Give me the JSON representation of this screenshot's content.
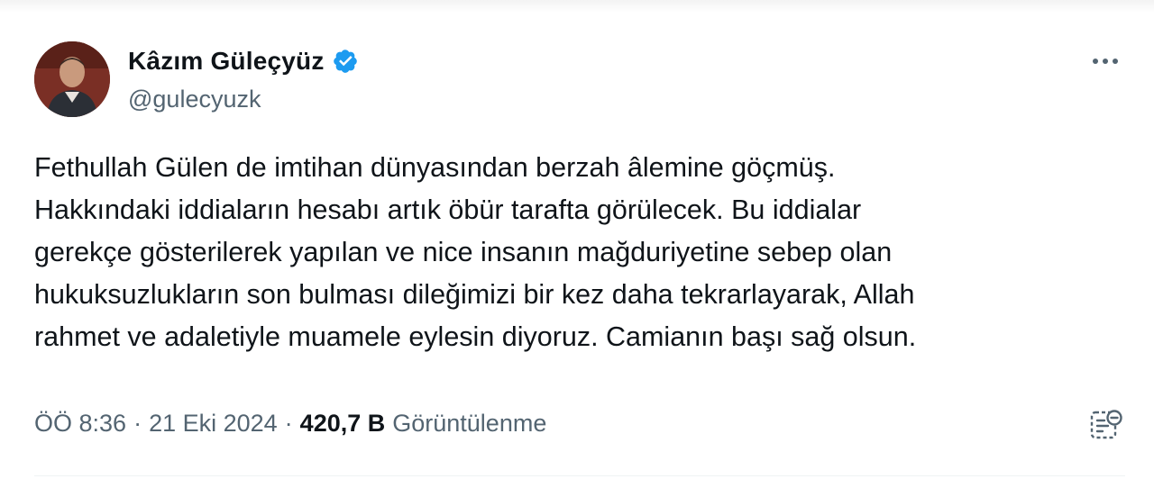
{
  "author": {
    "display_name": "Kâzım Güleçyüz",
    "handle": "@gulecyuzk",
    "verified_icon": "verified-badge-icon",
    "avatar_icon": "avatar"
  },
  "tweet": {
    "lines": [
      "Fethullah Gülen de imtihan dünyasından berzah âlemine göçmüş.",
      "Hakkındaki iddiaların hesabı artık öbür tarafta görülecek. Bu iddialar",
      "gerekçe gösterilerek yapılan ve nice insanın mağduriyetine sebep olan",
      "hukuksuzlukların son bulması dileğimizi bir kez daha tekrarlayarak, Allah",
      "rahmet ve adaletiyle muamele eylesin diyoruz. Camianın başı sağ olsun."
    ]
  },
  "meta": {
    "time": "ÖÖ 8:36",
    "separator": "·",
    "date": "21 Eki 2024",
    "views_count": "420,7 B",
    "views_label": "Görüntülenme"
  },
  "colors": {
    "text": "#0f1419",
    "secondary": "#536471",
    "verified": "#1d9bf0"
  }
}
